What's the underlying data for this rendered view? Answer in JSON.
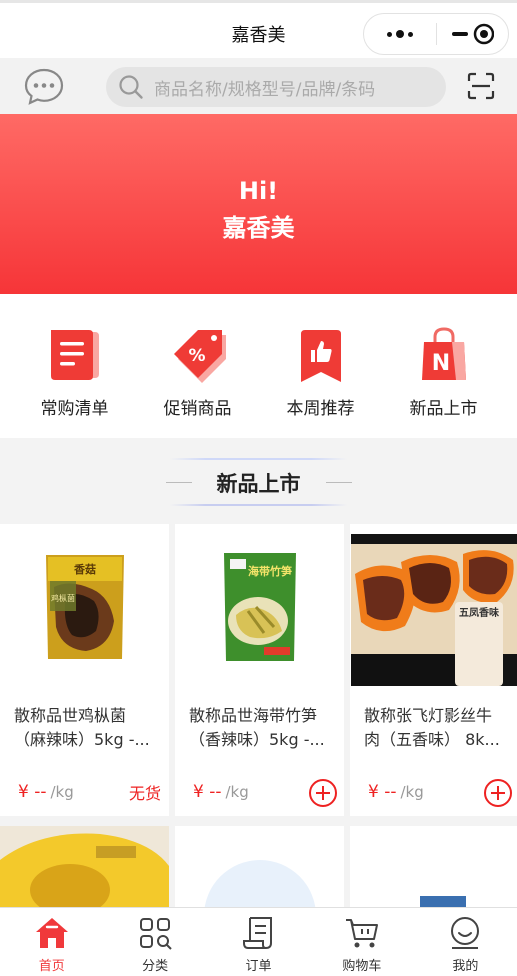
{
  "navbar": {
    "title": "嘉香美"
  },
  "search": {
    "placeholder": "商品名称/规格型号/品牌/条码"
  },
  "banner": {
    "greeting": "Hi!",
    "name": "嘉香美"
  },
  "categories": [
    {
      "label": "常购清单",
      "icon": "list-document-icon"
    },
    {
      "label": "促销商品",
      "icon": "discount-tag-icon"
    },
    {
      "label": "本周推荐",
      "icon": "thumbs-up-bookmark-icon"
    },
    {
      "label": "新品上市",
      "icon": "shopping-bag-new-icon"
    }
  ],
  "section": {
    "title": "新品上市"
  },
  "products": [
    {
      "name": "散称品世鸡枞菌（麻辣味）5kg -...",
      "price": "¥ --",
      "unit": "/kg",
      "status": "无货"
    },
    {
      "name": "散称品世海带竹笋（香辣味）5kg -...",
      "price": "¥ --",
      "unit": "/kg",
      "status": ""
    },
    {
      "name": "散称张飞灯影丝牛肉（五香味） 8k...",
      "price": "¥ --",
      "unit": "/kg",
      "status": ""
    }
  ],
  "product_images": {
    "p1": {
      "package_text": "香菇",
      "label": "鸡枞菌"
    },
    "p2": {
      "package_text": "海带竹笋"
    },
    "p3": {
      "scroll_text": "五凤香味"
    }
  },
  "tabs": [
    {
      "label": "首页",
      "icon": "home-icon",
      "active": true
    },
    {
      "label": "分类",
      "icon": "category-grid-icon",
      "active": false
    },
    {
      "label": "订单",
      "icon": "order-scroll-icon",
      "active": false
    },
    {
      "label": "购物车",
      "icon": "cart-icon",
      "active": false
    },
    {
      "label": "我的",
      "icon": "profile-icon",
      "active": false
    }
  ],
  "colors": {
    "accent": "#f0393b",
    "banner_top": "#ff6a65",
    "banner_bottom": "#f63538",
    "price": "#ee2222"
  }
}
